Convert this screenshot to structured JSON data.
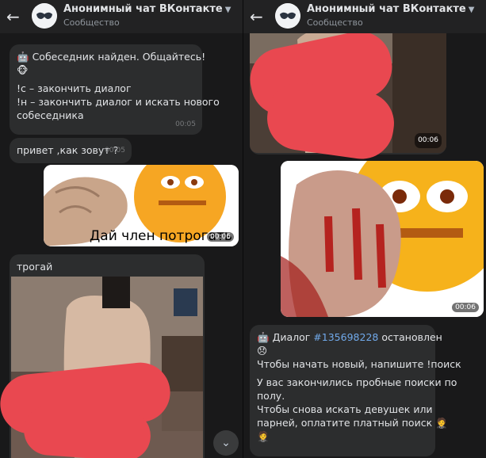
{
  "left": {
    "header": {
      "back_icon": "arrow-left-icon",
      "title": "Анонимный чат ВКонтакте",
      "subtitle": "Сообщество"
    },
    "msg_found": {
      "emoji": "🤖",
      "line1": "Собеседник найден. Общайтесь!",
      "emoji2": "🐵",
      "line3": "!с – закончить диалог",
      "line4": "!н – закончить диалог и искать нового",
      "line5": "собеседника",
      "time": "00:05"
    },
    "msg_hello": {
      "text": "привет ,как зовут ?",
      "time": "00:05"
    },
    "sticker_video": {
      "caption": "Дай член потрогать",
      "duration": "00:06"
    },
    "msg_trogay": {
      "text": "трогай"
    },
    "scroll_icon": "chevron-down-icon",
    "scroll_glyph": "⌄"
  },
  "right": {
    "header": {
      "back_icon": "arrow-left-icon",
      "title": "Анонимный чат ВКонтакте",
      "subtitle": "Сообщество"
    },
    "video_top": {
      "duration": "00:06"
    },
    "video_mid": {
      "duration": "00:06"
    },
    "msg_stopped": {
      "emoji": "🤖",
      "prefix": "Диалог ",
      "link": "#135698228",
      "suffix": " остановлен",
      "emoji2": "😞",
      "line2": "Чтобы начать новый, напишите !поиск",
      "line3": "У вас закончились пробные поиски по",
      "line4": "полу.",
      "line5": "Чтобы снова искать девушек или",
      "line6": "парней, оплатите платный поиск",
      "emoji3": "🤵",
      "emoji4": "🤵"
    }
  },
  "colors": {
    "background": "#19191a",
    "bubble": "#2c2d2e",
    "link": "#71aaeb",
    "redaction": "#e94850"
  }
}
